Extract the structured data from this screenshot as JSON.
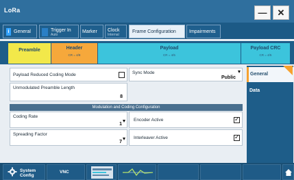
{
  "window": {
    "title": "LoRa",
    "minimize_label": "—",
    "close_label": "✕"
  },
  "tabs": [
    {
      "label": "General",
      "sublabel": ""
    },
    {
      "label": "Trigger In",
      "sublabel": "Auto"
    },
    {
      "label": "Marker",
      "sublabel": ""
    },
    {
      "label": "Clock",
      "sublabel": "Internal"
    },
    {
      "label": "Frame Configuration",
      "sublabel": ""
    },
    {
      "label": "Impairments",
      "sublabel": ""
    }
  ],
  "frame": {
    "segments": [
      {
        "label": "Preamble",
        "cr": ""
      },
      {
        "label": "Header",
        "cr": "CR = 4/8"
      },
      {
        "label": "Payload",
        "cr": "CR = 4/5"
      },
      {
        "label": "Payload CRC",
        "cr": "CR = 4/5"
      }
    ]
  },
  "fields": {
    "payload_reduced": {
      "label": "Payload Reduced Coding Mode",
      "checked": false
    },
    "sync_mode": {
      "label": "Sync Mode",
      "value": "Public"
    },
    "unmod_preamble": {
      "label": "Unmodulated Preamble Length",
      "value": "8"
    },
    "section_title": "Modulation and Coding Configuration",
    "coding_rate": {
      "label": "Coding Rate",
      "value": "1"
    },
    "encoder_active": {
      "label": "Encoder Active",
      "checked": true
    },
    "spreading_factor": {
      "label": "Spreading Factor",
      "value": "7"
    },
    "interleaver_active": {
      "label": "Interleaver Active",
      "checked": true
    }
  },
  "side_nav": {
    "items": [
      {
        "label": "General"
      },
      {
        "label": "Data"
      }
    ]
  },
  "bottom_bar": {
    "system_config_label": "System Config",
    "vnc_label": "VNC"
  },
  "colors": {
    "accent": "#f6a12e",
    "title_bar": "#2f6f9e",
    "preamble": "#f2e84a",
    "header": "#f6a83b",
    "payload": "#3cc4dc",
    "payload_crc": "#3cc4dc"
  }
}
